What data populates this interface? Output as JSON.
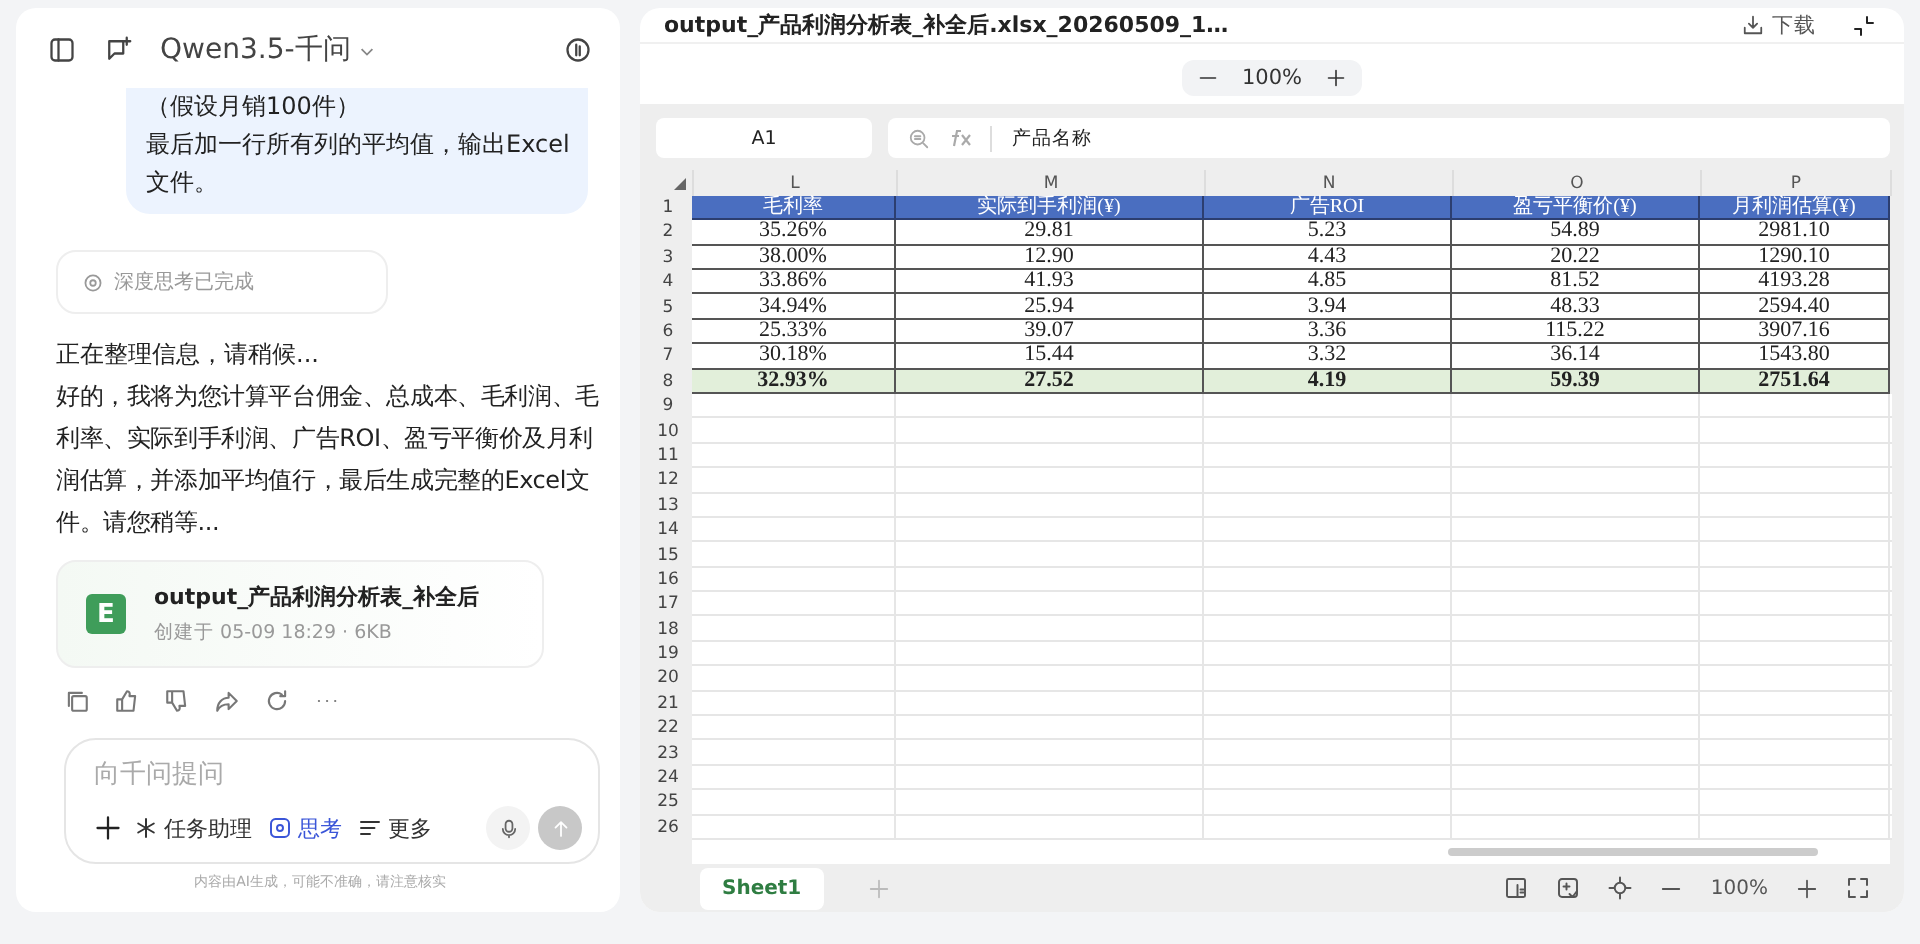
{
  "chat_header": {
    "model": "Qwen3.5-千问"
  },
  "user_message": {
    "lines": [
      "（假设月销100件）",
      "最后加一行所有列的平均值，输出Excel文件。"
    ]
  },
  "thinking_status": "深度思考已完成",
  "assistant": {
    "status": "正在整理信息，请稍候...",
    "reply": "好的，我将为您计算平台佣金、总成本、毛利润、毛利率、实际到手利润、广告ROI、盈亏平衡价及月利润估算，并添加平均值行，最后生成完整的Excel文件。请您稍等..."
  },
  "file_card": {
    "badge": "E",
    "name": "output_产品利润分析表_补全后",
    "meta": "创建于 05-09 18:29 · 6KB"
  },
  "composer": {
    "placeholder": "向千问提问",
    "tools": [
      {
        "label": "任务助理",
        "selected": false
      },
      {
        "label": "思考",
        "selected": true
      },
      {
        "label": "更多",
        "selected": false
      }
    ]
  },
  "disclaimer": "内容由AI生成，可能不准确，请注意核实",
  "viewer": {
    "title": "output_产品利润分析表_补全后.xlsx_20260509_1…",
    "download": "下载",
    "zoom": "100%"
  },
  "sheet": {
    "cell_ref": "A1",
    "formula": "产品名称",
    "columns": [
      "L",
      "M",
      "N",
      "O",
      "P"
    ],
    "row_numbers": [
      "1",
      "2",
      "3",
      "4",
      "5",
      "6",
      "7",
      "8",
      "9",
      "10",
      "11",
      "12",
      "13",
      "14",
      "15",
      "16",
      "17",
      "18",
      "19",
      "20",
      "21",
      "22",
      "23",
      "24",
      "25",
      "26"
    ],
    "rows": [
      {
        "kind": "header",
        "cells": [
          "毛利率",
          "实际到手利润(¥)",
          "广告ROI",
          "盈亏平衡价(¥)",
          "月利润估算(¥)"
        ]
      },
      {
        "kind": "data",
        "cells": [
          "35.26%",
          "29.81",
          "5.23",
          "54.89",
          "2981.10"
        ]
      },
      {
        "kind": "data",
        "cells": [
          "38.00%",
          "12.90",
          "4.43",
          "20.22",
          "1290.10"
        ]
      },
      {
        "kind": "data",
        "cells": [
          "33.86%",
          "41.93",
          "4.85",
          "81.52",
          "4193.28"
        ]
      },
      {
        "kind": "data",
        "cells": [
          "34.94%",
          "25.94",
          "3.94",
          "48.33",
          "2594.40"
        ]
      },
      {
        "kind": "data",
        "cells": [
          "25.33%",
          "39.07",
          "3.36",
          "115.22",
          "3907.16"
        ]
      },
      {
        "kind": "data",
        "cells": [
          "30.18%",
          "15.44",
          "3.32",
          "36.14",
          "1543.80"
        ]
      },
      {
        "kind": "average",
        "cells": [
          "32.93%",
          "27.52",
          "4.19",
          "59.39",
          "2751.64"
        ]
      }
    ],
    "tabs": [
      {
        "label": "Sheet1",
        "selected": true
      }
    ],
    "status_zoom": "100%"
  }
}
